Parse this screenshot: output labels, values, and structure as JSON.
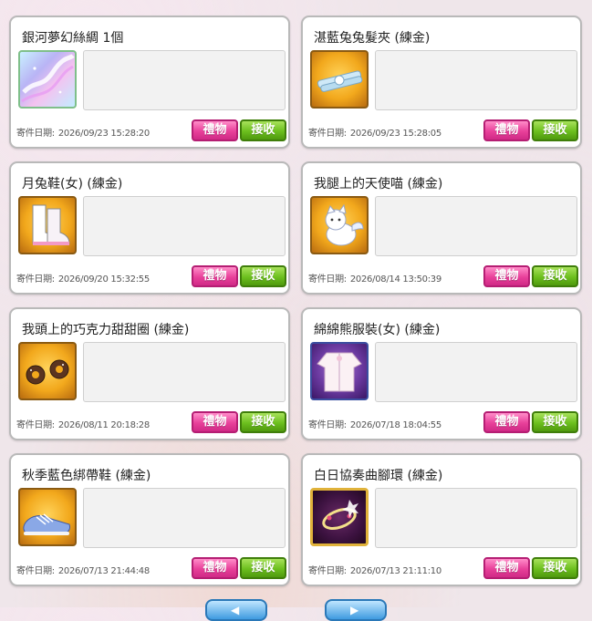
{
  "labels": {
    "date_label": "寄件日期:",
    "gift": "禮物",
    "receive": "接收"
  },
  "mails": [
    {
      "title": "銀河夢幻絲綢 1個",
      "date": "2026/09/23 15:28:20",
      "icon": "galaxy-silk-icon"
    },
    {
      "title": "湛藍兔兔髮夾 (練金)",
      "date": "2026/09/23 15:28:05",
      "icon": "blue-bunny-hairclip-icon"
    },
    {
      "title": "月兔鞋(女) (練金)",
      "date": "2026/09/20 15:32:55",
      "icon": "moon-rabbit-boots-icon"
    },
    {
      "title": "我腿上的天使喵 (練金)",
      "date": "2026/08/14 13:50:39",
      "icon": "angel-cat-icon"
    },
    {
      "title": "我頭上的巧克力甜甜圈 (練金)",
      "date": "2026/08/11 20:18:28",
      "icon": "chocolate-donut-icon"
    },
    {
      "title": "綿綿熊服裝(女) (練金)",
      "date": "2026/07/18 18:04:55",
      "icon": "fluffy-bear-outfit-icon"
    },
    {
      "title": "秋季藍色綁帶鞋 (練金)",
      "date": "2026/07/13 21:44:48",
      "icon": "blue-laced-shoes-icon"
    },
    {
      "title": "白日協奏曲腳環 (練金)",
      "date": "2026/07/13 21:11:10",
      "icon": "daylight-concerto-anklet-icon"
    }
  ],
  "colors": {
    "gift_button": "#e8409a",
    "receive_button": "#6cbf1e",
    "item_frame_gold": "#e7a21b",
    "item_frame_purple": "#5a2a88"
  }
}
